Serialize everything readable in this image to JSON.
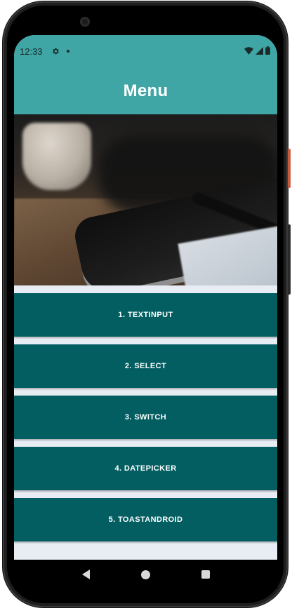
{
  "status_bar": {
    "time": "12:33"
  },
  "app_bar": {
    "title": "Menu"
  },
  "menu": {
    "items": [
      {
        "label": "1.  TEXTINPUT"
      },
      {
        "label": "2.  SELECT"
      },
      {
        "label": "3.  SWITCH"
      },
      {
        "label": "4.  DATEPICKER"
      },
      {
        "label": "5.  TOASTANDROID"
      }
    ]
  },
  "colors": {
    "app_bar": "#3fa5a5",
    "menu_button": "#035e62",
    "background": "#e8edf4"
  },
  "icons": {
    "status_settings": "gear-icon",
    "status_wifi": "wifi-icon",
    "status_signal": "signal-icon",
    "status_battery": "battery-icon",
    "nav_back": "back-icon",
    "nav_home": "home-icon",
    "nav_recent": "recent-apps-icon"
  }
}
